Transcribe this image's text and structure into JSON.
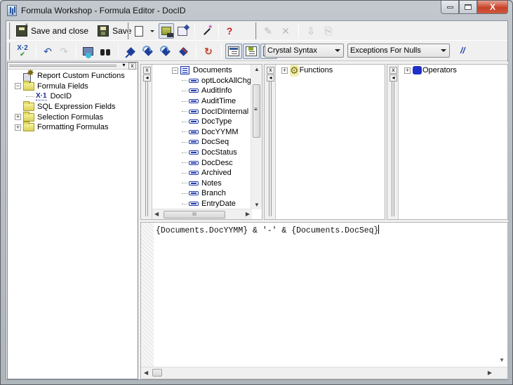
{
  "window": {
    "title": "Formula Workshop - Formula Editor - DocID",
    "controls": {
      "minimize": "minimize",
      "maximize": "maximize",
      "close": "X"
    }
  },
  "toolbar1": {
    "save_and_close": "Save and close",
    "save": "Save",
    "buttons": [
      "new-formula",
      "new-dropdown",
      "toggle-tree",
      "toggle-properties",
      "use-expert",
      "help",
      "new-disabled",
      "delete-disabled",
      "browse-data-disabled",
      "rename-disabled"
    ],
    "help_glyph": "?",
    "delete_glyph": "✕"
  },
  "toolbar2": {
    "check_glyph_top": "X·2",
    "check_glyph_bottom": "✔",
    "undo_glyph": "↶",
    "redo_glyph": "↷",
    "refresh_glyph": "↻",
    "syntax_select": {
      "selected": "Crystal Syntax"
    },
    "null_select": {
      "selected": "Exceptions For Nulls"
    },
    "comment_label": "//"
  },
  "workshop_tree": {
    "items": [
      {
        "label": "Report Custom Functions",
        "expander": "",
        "icon": "gear-doc"
      },
      {
        "label": "Formula Fields",
        "expander": "−",
        "icon": "folder"
      },
      {
        "label": "DocID",
        "expander": "",
        "icon": "formula-x1",
        "icon_text": "X·1",
        "selected": true
      },
      {
        "label": "SQL Expression Fields",
        "expander": "",
        "icon": "folder"
      },
      {
        "label": "Selection Formulas",
        "expander": "+",
        "icon": "folder"
      },
      {
        "label": "Formatting Formulas",
        "expander": "+",
        "icon": "folder"
      }
    ]
  },
  "fields_tree": {
    "table": {
      "label": "Documents",
      "expander": "−"
    },
    "fields": [
      "optLockAllChg",
      "AuditInfo",
      "AuditTime",
      "DocIDInternal",
      "DocType",
      "DocYYMM",
      "DocSeq",
      "DocStatus",
      "DocDesc",
      "Archived",
      "Notes",
      "Branch",
      "EntryDate"
    ],
    "hscroll_grip": "III",
    "vscroll_grip": "≡"
  },
  "functions_tree": {
    "label": "Functions",
    "expander": "+"
  },
  "operators_tree": {
    "label": "Operators",
    "expander": "+"
  },
  "editor": {
    "formula_text": "{Documents.DocYYMM} & '-' & {Documents.DocSeq}"
  },
  "pane_controls": {
    "close": "x",
    "collapse": "◂",
    "menu": "▾"
  }
}
